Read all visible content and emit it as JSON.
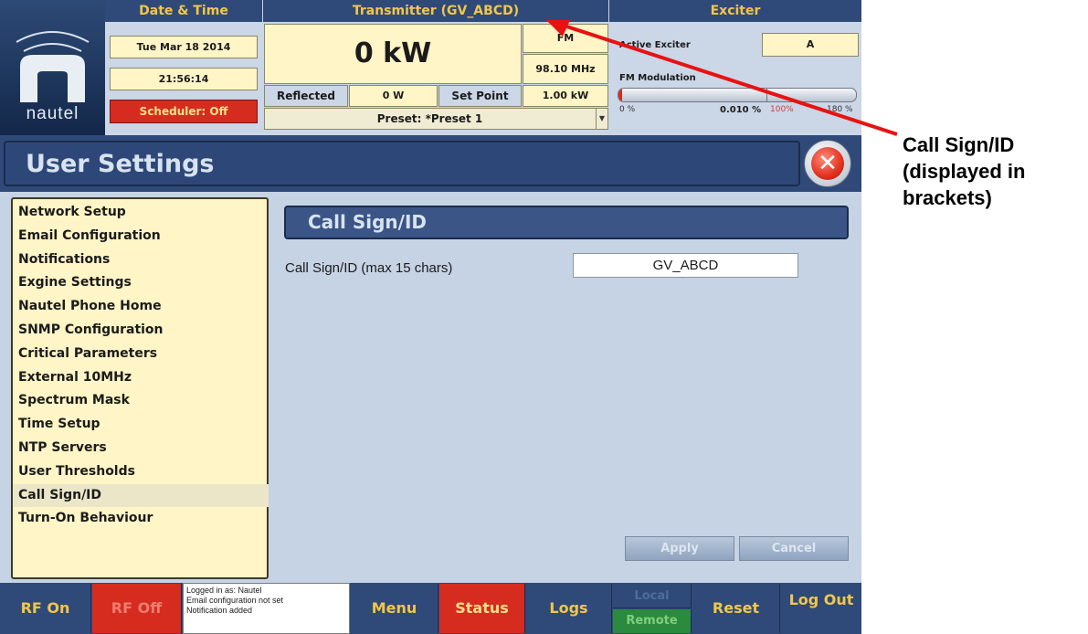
{
  "header": {
    "datetime_title": "Date & Time",
    "date": "Tue Mar 18 2014",
    "time": "21:56:14",
    "scheduler": "Scheduler: Off",
    "transmitter_title": "Transmitter (GV_ABCD)",
    "power": "0 kW",
    "band": "FM",
    "frequency": "98.10 MHz",
    "reflected_label": "Reflected",
    "reflected_value": "0 W",
    "set_point_label": "Set Point",
    "set_point_value": "1.00 kW",
    "preset": "Preset: *Preset 1",
    "exciter_title": "Exciter",
    "active_exciter_label": "Active Exciter",
    "active_exciter_value": "A",
    "fm_modulation_label": "FM Modulation",
    "fm_modulation_value": "0.010 %",
    "fm_modulation_fraction": 0.0001,
    "scale_min": "0 %",
    "scale_mid": "100%",
    "scale_max": "180 %"
  },
  "logo": {
    "text": "nautel"
  },
  "page": {
    "title": "User Settings"
  },
  "menu": {
    "items": [
      "Network Setup",
      "Email Configuration",
      "Notifications",
      "Exgine Settings",
      "Nautel Phone Home",
      "SNMP Configuration",
      "Critical Parameters",
      "External 10MHz",
      "Spectrum Mask",
      "Time Setup",
      "NTP Servers",
      "User Thresholds",
      "Call Sign/ID",
      "Turn-On Behaviour"
    ],
    "selected": "Call Sign/ID"
  },
  "content": {
    "title": "Call Sign/ID",
    "field_label": "Call Sign/ID (max 15 chars)",
    "field_value": "GV_ABCD",
    "apply_label": "Apply",
    "cancel_label": "Cancel"
  },
  "bottom": {
    "rf_on": "RF On",
    "rf_off": "RF Off",
    "log_lines": [
      "Logged in as: Nautel",
      "Email configuration not set",
      "Notification added"
    ],
    "menu": "Menu",
    "status": "Status",
    "logs": "Logs",
    "local": "Local",
    "remote": "Remote",
    "reset": "Reset",
    "logout": "Log Out"
  },
  "annotation": {
    "lines": [
      "Call Sign/ID",
      "(displayed in",
      "brackets)"
    ]
  },
  "colors": {
    "header_blue": "#2f4a78",
    "title_yellow": "#f2c64a",
    "value_box": "#fff5c6",
    "alert_red": "#d62c1f",
    "panel_bg": "#c6d3e4",
    "remote_green": "#2b8a3e",
    "annotation_arrow": "#e81212"
  }
}
